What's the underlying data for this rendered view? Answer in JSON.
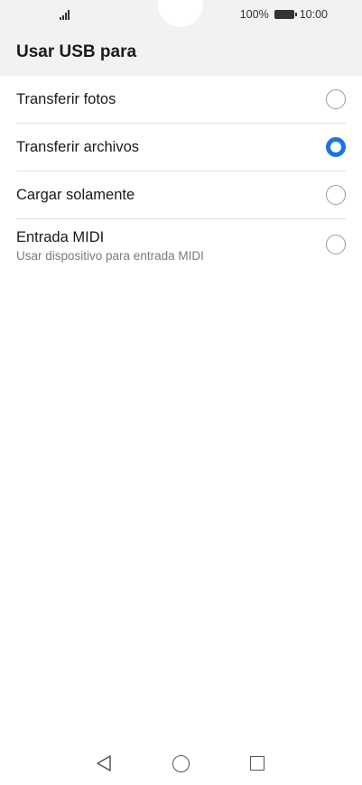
{
  "status_bar": {
    "battery_percent": "100%",
    "time": "10:00",
    "icons": [
      "signal-icon",
      "battery-icon"
    ]
  },
  "header": {
    "title": "Usar USB para"
  },
  "options": [
    {
      "label": "Transferir fotos",
      "subtitle": "",
      "selected": false
    },
    {
      "label": "Transferir archivos",
      "subtitle": "",
      "selected": true
    },
    {
      "label": "Cargar solamente",
      "subtitle": "",
      "selected": false
    },
    {
      "label": "Entrada MIDI",
      "subtitle": "Usar dispositivo para entrada MIDI",
      "selected": false
    }
  ],
  "navbar": {
    "icons": [
      "back-icon",
      "home-icon",
      "recent-apps-icon"
    ]
  },
  "colors": {
    "accent": "#1a73e8",
    "header_bg": "#f2f2f2",
    "divider": "#dedede"
  }
}
